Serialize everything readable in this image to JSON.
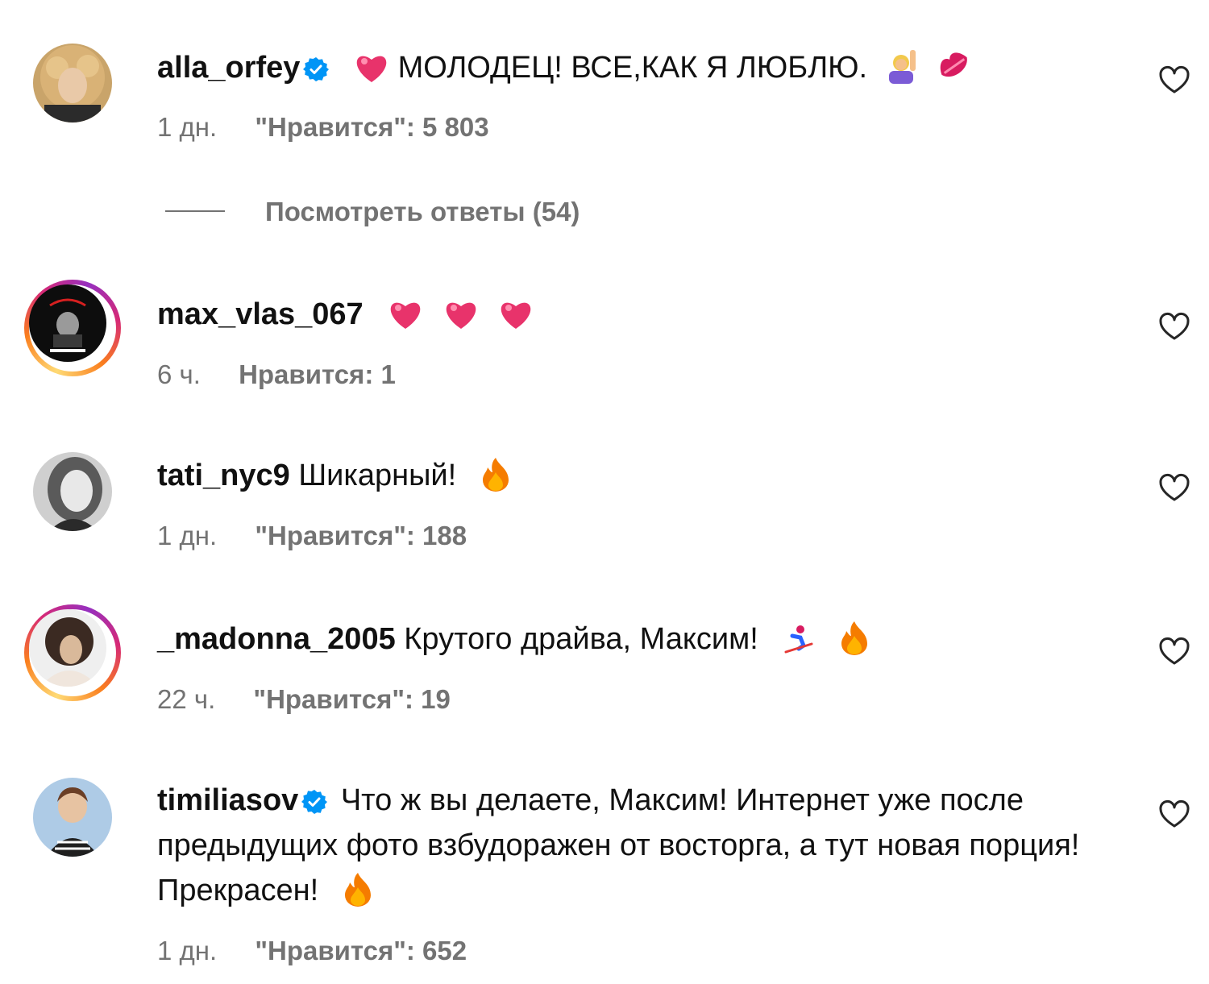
{
  "colors": {
    "text": "#111111",
    "meta": "#737373",
    "verified": "#0095f6",
    "story_ring": [
      "#feda75",
      "#fa7e1e",
      "#d62976",
      "#962fbf"
    ]
  },
  "comments": [
    {
      "username": "alla_orfey",
      "verified": true,
      "text": "МОЛОДЕЦ! ВСЕ,КАК Я ЛЮБЛЮ.",
      "emojis_before": [
        "heart"
      ],
      "emojis_after": [
        "person-raising-hand",
        "kiss-mark"
      ],
      "time": "1 дн.",
      "likes": "\"Нравится\": 5 803",
      "story_ring": false,
      "replies_label": "Посмотреть ответы (54)"
    },
    {
      "username": "max_vlas_067",
      "verified": false,
      "text": "",
      "emojis_after": [
        "heart",
        "heart",
        "heart"
      ],
      "time": "6 ч.",
      "likes": "Нравится: 1",
      "story_ring": true
    },
    {
      "username": "tati_nyc9",
      "verified": false,
      "text": "Шикарный!",
      "emojis_after": [
        "fire"
      ],
      "time": "1 дн.",
      "likes": "\"Нравится\": 188",
      "story_ring": false
    },
    {
      "username": "_madonna_2005",
      "verified": false,
      "text": "Крутого драйва, Максим!",
      "emojis_after": [
        "skier",
        "fire"
      ],
      "time": "22 ч.",
      "likes": "\"Нравится\": 19",
      "story_ring": true
    },
    {
      "username": "timiliasov",
      "verified": true,
      "text": "Что ж вы делаете, Максим! Интернет уже после предыдущих фото взбудоражен от восторга, а тут новая порция! Прекрасен!",
      "emojis_after": [
        "fire"
      ],
      "time": "1 дн.",
      "likes": "\"Нравится\": 652",
      "story_ring": false
    }
  ],
  "icons": {
    "like": "heart-outline-icon",
    "verified": "verified-badge-icon"
  }
}
